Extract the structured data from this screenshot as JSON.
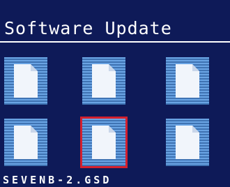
{
  "header": {
    "title": "Software Update"
  },
  "files": [
    {
      "row": 1,
      "col": 1,
      "icon": "document-icon",
      "selected": false
    },
    {
      "row": 1,
      "col": 2,
      "icon": "document-icon",
      "selected": false
    },
    {
      "row": 1,
      "col": 3,
      "icon": "document-icon",
      "selected": false
    },
    {
      "row": 2,
      "col": 1,
      "icon": "document-icon",
      "selected": false
    },
    {
      "row": 2,
      "col": 2,
      "icon": "document-icon",
      "selected": true
    },
    {
      "row": 2,
      "col": 3,
      "icon": "document-icon",
      "selected": false
    }
  ],
  "status": {
    "selected_filename": "SEVENB-2.GSD"
  },
  "colors": {
    "background": "#0e1a58",
    "tile": "#5b93d4",
    "selection": "#d3202e",
    "text": "#ffffff"
  }
}
